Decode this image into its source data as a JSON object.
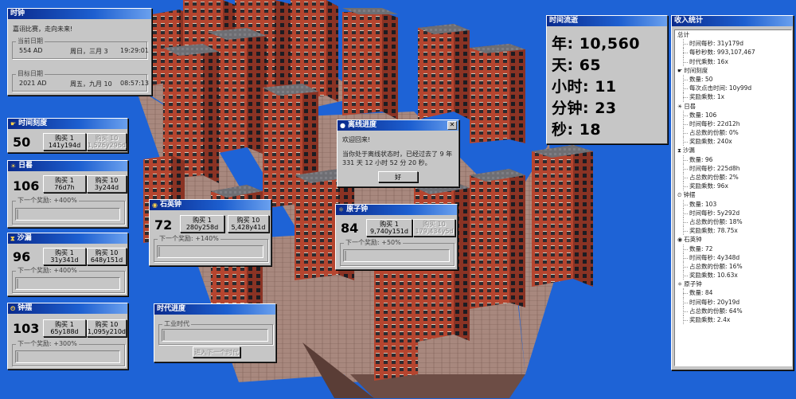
{
  "colors": {
    "sky": "#1e63d6",
    "title_start": "#0a2a8c",
    "title_end": "#6aa0ee",
    "window_face": "#c6c6c6",
    "brick": "#b94a33",
    "stone": "#9a8f85"
  },
  "clock": {
    "title": "时钟",
    "greeting": "嘉诩比赛，走向未来!",
    "current_label": "当前日期",
    "current": {
      "year": "554 AD",
      "weekday_date": "周日，三月 3",
      "time": "19:29:01"
    },
    "target_label": "目标日期",
    "target": {
      "year": "2021 AD",
      "weekday_date": "周五，九月 10",
      "time": "08:57:13"
    }
  },
  "elapsed": {
    "title": "时间流逝",
    "lines": [
      "年: 10,560",
      "天: 65",
      "小时: 11",
      "分钟: 23",
      "秒: 18"
    ]
  },
  "offline": {
    "title": "离线进度",
    "welcome": "欢迎回来!",
    "message": "当你处于离线状态时，已经过去了 9 年 331 天 12 小时 52 分 20 秒。",
    "ok": "好"
  },
  "generators": [
    {
      "id": "tick",
      "title": "时间刻度",
      "icon": "☛",
      "count": "50",
      "buy1": [
        "购买 1",
        "141y194d"
      ],
      "buy10": [
        "购买 10",
        "1,526y296d"
      ],
      "buy10_disabled": true
    },
    {
      "id": "sundial",
      "title": "日晷",
      "icon": "☀",
      "count": "106",
      "buy1": [
        "购买 1",
        "76d7h"
      ],
      "buy10": [
        "购买 10",
        "3y244d"
      ],
      "buy10_disabled": false,
      "next_label": "下一个奖励: +400%"
    },
    {
      "id": "hourglass",
      "title": "沙漏",
      "icon": "⧗",
      "count": "96",
      "buy1": [
        "购买 1",
        "31y341d"
      ],
      "buy10": [
        "购买 10",
        "648y151d"
      ],
      "buy10_disabled": false,
      "next_label": "下一个奖励: +400%"
    },
    {
      "id": "pendulum",
      "title": "钟摆",
      "icon": "⏲",
      "count": "103",
      "buy1": [
        "购买 1",
        "65y188d"
      ],
      "buy10": [
        "购买 10",
        "1,095y210d"
      ],
      "buy10_disabled": false,
      "next_label": "下一个奖励: +300%"
    },
    {
      "id": "quartz",
      "title": "石英钟",
      "icon": "◉",
      "count": "72",
      "buy1": [
        "购买 1",
        "280y258d"
      ],
      "buy10": [
        "购买 10",
        "5,428y41d"
      ],
      "buy10_disabled": false,
      "next_label": "下一个奖励: +140%"
    },
    {
      "id": "atomic",
      "title": "原子钟",
      "icon": "⚛",
      "count": "84",
      "buy1": [
        "购买 1",
        "9,740y151d"
      ],
      "buy10": [
        "购买 10",
        "179,434y5d"
      ],
      "buy10_disabled": true,
      "next_label": "下一个奖励: +50%"
    }
  ],
  "era": {
    "title": "时代进度",
    "era_label": "工业时代",
    "advance": "进入下一个时代"
  },
  "stats": {
    "title": "收入统计",
    "rows": [
      {
        "t": "head",
        "text": "总计",
        "icon": ""
      },
      {
        "t": "child",
        "text": "时间每秒: 31y179d"
      },
      {
        "t": "child",
        "text": "每秒秒数: 993,107,467"
      },
      {
        "t": "child",
        "text": "时代乘数: 16x"
      },
      {
        "t": "head",
        "text": "时间刻度",
        "icon": "☛"
      },
      {
        "t": "child",
        "text": "数量: 50"
      },
      {
        "t": "child",
        "text": "每次点击时间: 10y99d"
      },
      {
        "t": "child",
        "text": "奖励乘数: 1x"
      },
      {
        "t": "head",
        "text": "日晷",
        "icon": "☀"
      },
      {
        "t": "child",
        "text": "数量: 106"
      },
      {
        "t": "child",
        "text": "时间每秒: 22d12h"
      },
      {
        "t": "child",
        "text": "占总数的份额: 0%"
      },
      {
        "t": "child",
        "text": "奖励乘数: 240x"
      },
      {
        "t": "head",
        "text": "沙漏",
        "icon": "⧗"
      },
      {
        "t": "child",
        "text": "数量: 96"
      },
      {
        "t": "child",
        "text": "时间每秒: 225d8h"
      },
      {
        "t": "child",
        "text": "占总数的份额: 2%"
      },
      {
        "t": "child",
        "text": "奖励乘数: 96x"
      },
      {
        "t": "head",
        "text": "钟摆",
        "icon": "⏲"
      },
      {
        "t": "child",
        "text": "数量: 103"
      },
      {
        "t": "child",
        "text": "时间每秒: 5y292d"
      },
      {
        "t": "child",
        "text": "占总数的份额: 18%"
      },
      {
        "t": "child",
        "text": "奖励乘数: 78.75x"
      },
      {
        "t": "head",
        "text": "石英钟",
        "icon": "◉"
      },
      {
        "t": "child",
        "text": "数量: 72"
      },
      {
        "t": "child",
        "text": "时间每秒: 4y348d"
      },
      {
        "t": "child",
        "text": "占总数的份额: 16%"
      },
      {
        "t": "child",
        "text": "奖励乘数: 10.63x"
      },
      {
        "t": "head",
        "text": "原子钟",
        "icon": "⚛"
      },
      {
        "t": "child",
        "text": "数量: 84"
      },
      {
        "t": "child",
        "text": "时间每秒: 20y19d"
      },
      {
        "t": "child",
        "text": "占总数的份额: 64%"
      },
      {
        "t": "child",
        "text": "奖励乘数: 2.4x"
      }
    ]
  }
}
